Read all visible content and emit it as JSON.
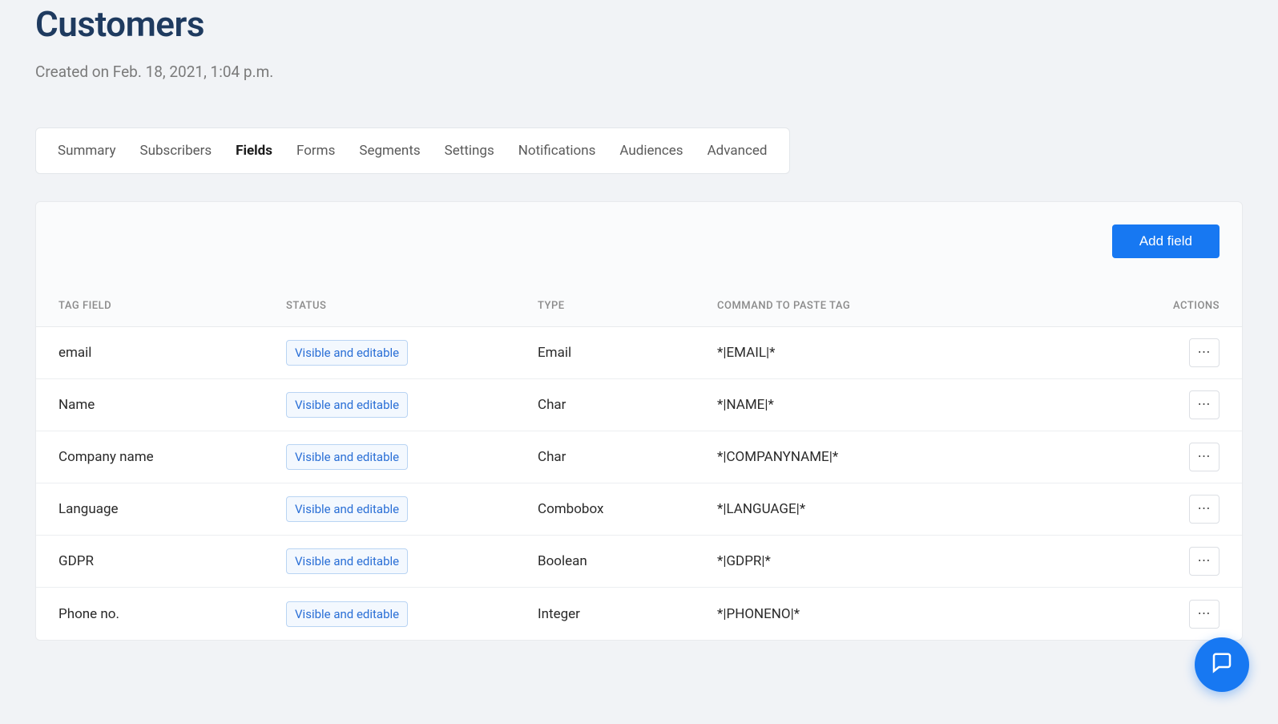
{
  "header": {
    "title": "Customers",
    "subtitle": "Created on Feb. 18, 2021, 1:04 p.m."
  },
  "tabs": [
    {
      "label": "Summary",
      "active": false
    },
    {
      "label": "Subscribers",
      "active": false
    },
    {
      "label": "Fields",
      "active": true
    },
    {
      "label": "Forms",
      "active": false
    },
    {
      "label": "Segments",
      "active": false
    },
    {
      "label": "Settings",
      "active": false
    },
    {
      "label": "Notifications",
      "active": false
    },
    {
      "label": "Audiences",
      "active": false
    },
    {
      "label": "Advanced",
      "active": false
    }
  ],
  "toolbar": {
    "add_field_label": "Add field"
  },
  "table": {
    "columns": {
      "tag_field": "TAG FIELD",
      "status": "STATUS",
      "type": "TYPE",
      "command": "COMMAND TO PASTE TAG",
      "actions": "ACTIONS"
    },
    "status_label": "Visible and editable",
    "rows": [
      {
        "tag": "email",
        "status": "Visible and editable",
        "type": "Email",
        "command": "*|EMAIL|*"
      },
      {
        "tag": "Name",
        "status": "Visible and editable",
        "type": "Char",
        "command": "*|NAME|*"
      },
      {
        "tag": "Company name",
        "status": "Visible and editable",
        "type": "Char",
        "command": "*|COMPANYNAME|*"
      },
      {
        "tag": "Language",
        "status": "Visible and editable",
        "type": "Combobox",
        "command": "*|LANGUAGE|*"
      },
      {
        "tag": "GDPR",
        "status": "Visible and editable",
        "type": "Boolean",
        "command": "*|GDPR|*"
      },
      {
        "tag": "Phone no.",
        "status": "Visible and editable",
        "type": "Integer",
        "command": "*|PHONENO|*"
      }
    ]
  },
  "help_fab": {
    "icon": "chat-icon"
  }
}
